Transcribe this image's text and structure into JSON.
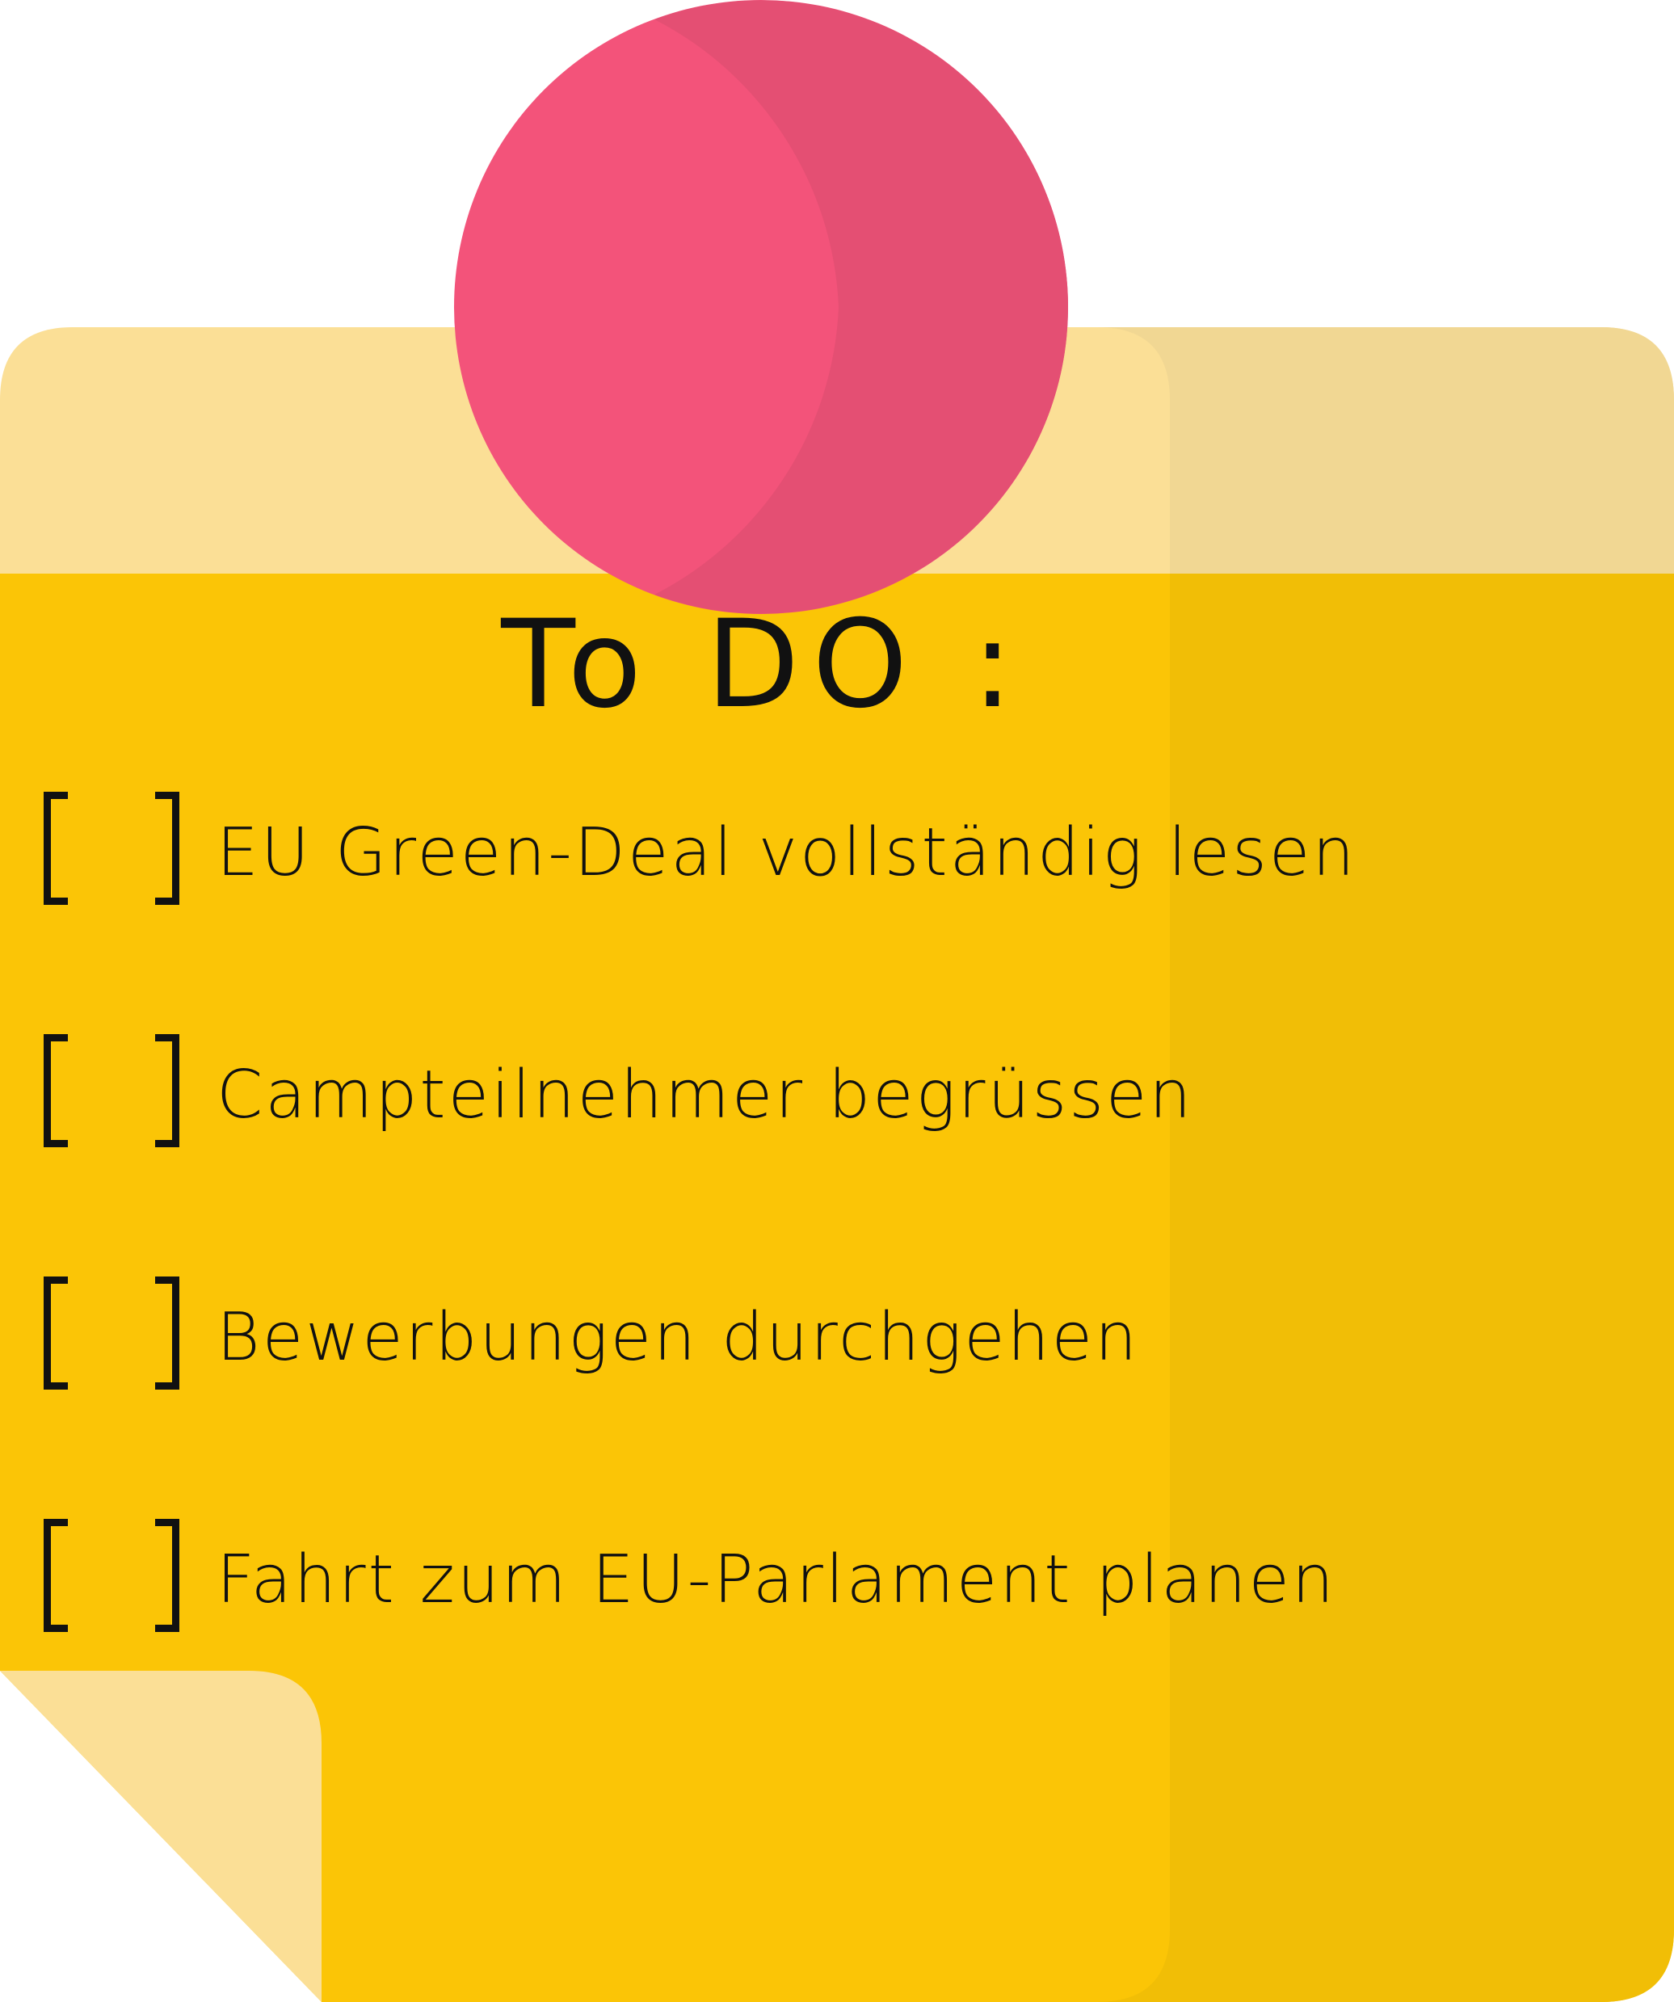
{
  "note": {
    "title": "To DO :",
    "items": [
      {
        "label": "EU Green-Deal vollständig lesen",
        "checked": false
      },
      {
        "label": "Campteilnehmer begrüssen",
        "checked": false
      },
      {
        "label": "Bewerbungen durchgehen",
        "checked": false
      },
      {
        "label": "Fahrt zum EU-Parlament planen",
        "checked": false
      }
    ]
  },
  "colors": {
    "paper": "#FBC506",
    "paper_shade": "#F1BE06",
    "paper_top": "#FBDF96",
    "paper_top_shade": "#F1D793",
    "fold": "#FBDF96",
    "pin": "#F3537A",
    "pin_shade": "#E44F73",
    "ink": "#111111"
  },
  "icons": {
    "pin": "pushpin-circle-icon",
    "checkbox": "bracket-checkbox-icon"
  }
}
